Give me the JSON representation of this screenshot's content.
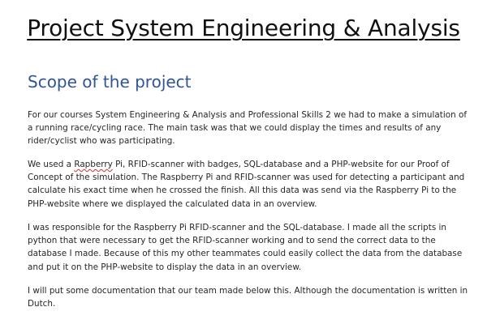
{
  "document": {
    "title": "Project System Engineering & Analysis",
    "section_heading": "Scope of the project",
    "paragraphs": [
      "For our courses System Engineering & Analysis and Professional Skills 2 we had to make a simulation of a running race/cycling race. The main task was that we could display the times and results of any rider/cyclist who was participating.",
      {
        "before": "We used a ",
        "flagged_word": "Rapberry",
        "after": " Pi, RFID-scanner with badges, SQL-database and a PHP-website for our Proof of Concept of the simulation. The Raspberry Pi and RFID-scanner was used for detecting a participant and calculate his exact time when he crossed the finish. All this data was send via the Raspberry Pi to the PHP-website where we displayed the calculated data in an overview."
      },
      "I was responsible for the Raspberry Pi RFID-scanner and the SQL-database. I made all the scripts in python that were necessary to get the RFID-scanner working and to send the correct data to the database I made. Because of this my other teammates could easily collect the data from the database and put it on the PHP-website to display the data in an overview.",
      "I will put some documentation that our team made below this. Although the documentation is written in Dutch."
    ]
  },
  "colors": {
    "heading": "#2f5597",
    "body_text": "#262626",
    "spellcheck_underline": "#d03030"
  }
}
